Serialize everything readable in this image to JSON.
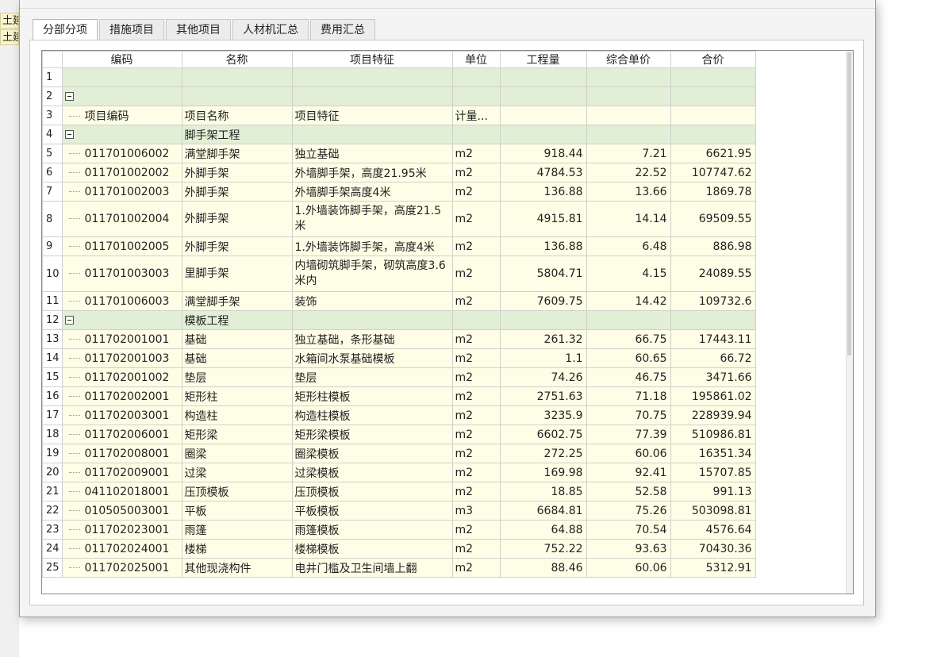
{
  "background": {
    "fragments": [
      "土建",
      "土建"
    ]
  },
  "tabs": [
    {
      "label": "分部分项",
      "active": true
    },
    {
      "label": "措施项目",
      "active": false
    },
    {
      "label": "其他项目",
      "active": false
    },
    {
      "label": "人材机汇总",
      "active": false
    },
    {
      "label": "费用汇总",
      "active": false
    }
  ],
  "grid": {
    "columns": [
      "编码",
      "名称",
      "项目特征",
      "单位",
      "工程量",
      "综合单价",
      "合价"
    ],
    "rows": [
      {
        "num": "1",
        "type": "green",
        "expander": false,
        "code": "",
        "name": "",
        "feature": "",
        "unit": "",
        "qty": "",
        "price": "",
        "total": ""
      },
      {
        "num": "2",
        "type": "green",
        "expander": true,
        "code": "",
        "name": "",
        "feature": "",
        "unit": "",
        "qty": "",
        "price": "",
        "total": ""
      },
      {
        "num": "3",
        "type": "yellow",
        "expander": false,
        "line": true,
        "code": "项目编码",
        "name": "项目名称",
        "feature": "项目特征",
        "unit": "计量...",
        "qty": "",
        "price": "",
        "total": ""
      },
      {
        "num": "4",
        "type": "green",
        "expander": true,
        "code": "",
        "name": "脚手架工程",
        "feature": "",
        "unit": "",
        "qty": "",
        "price": "",
        "total": ""
      },
      {
        "num": "5",
        "type": "yellow",
        "line": true,
        "code": "011701006002",
        "name": "满堂脚手架",
        "feature": "独立基础",
        "unit": "m2",
        "qty": "918.44",
        "price": "7.21",
        "total": "6621.95"
      },
      {
        "num": "6",
        "type": "yellow",
        "line": true,
        "code": "011701002002",
        "name": "外脚手架",
        "feature": "外墙脚手架，高度21.95米",
        "unit": "m2",
        "qty": "4784.53",
        "price": "22.52",
        "total": "107747.62"
      },
      {
        "num": "7",
        "type": "yellow",
        "line": true,
        "code": "011701002003",
        "name": "外脚手架",
        "feature": "外墙脚手架高度4米",
        "unit": "m2",
        "qty": "136.88",
        "price": "13.66",
        "total": "1869.78"
      },
      {
        "num": "8",
        "type": "yellow",
        "line": true,
        "tall": true,
        "code": "011701002004",
        "name": "外脚手架",
        "feature": "1.外墙装饰脚手架，高度21.5米",
        "unit": "m2",
        "qty": "4915.81",
        "price": "14.14",
        "total": "69509.55"
      },
      {
        "num": "9",
        "type": "yellow",
        "line": true,
        "code": "011701002005",
        "name": "外脚手架",
        "feature": "1.外墙装饰脚手架，高度4米",
        "unit": "m2",
        "qty": "136.88",
        "price": "6.48",
        "total": "886.98"
      },
      {
        "num": "10",
        "type": "yellow",
        "line": true,
        "tall": true,
        "code": "011701003003",
        "name": "里脚手架",
        "feature": "内墙砌筑脚手架，砌筑高度3.6米内",
        "unit": "m2",
        "qty": "5804.71",
        "price": "4.15",
        "total": "24089.55"
      },
      {
        "num": "11",
        "type": "yellow",
        "line": true,
        "code": "011701006003",
        "name": "满堂脚手架",
        "feature": "装饰",
        "unit": "m2",
        "qty": "7609.75",
        "price": "14.42",
        "total": "109732.6"
      },
      {
        "num": "12",
        "type": "green",
        "expander": true,
        "code": "",
        "name": "模板工程",
        "feature": "",
        "unit": "",
        "qty": "",
        "price": "",
        "total": ""
      },
      {
        "num": "13",
        "type": "yellow",
        "line": true,
        "code": "011702001001",
        "name": "基础",
        "feature": "独立基础，条形基础",
        "unit": "m2",
        "qty": "261.32",
        "price": "66.75",
        "total": "17443.11"
      },
      {
        "num": "14",
        "type": "yellow",
        "line": true,
        "code": "011702001003",
        "name": "基础",
        "feature": "水箱间水泵基础模板",
        "unit": "m2",
        "qty": "1.1",
        "price": "60.65",
        "total": "66.72"
      },
      {
        "num": "15",
        "type": "yellow",
        "line": true,
        "code": "011702001002",
        "name": "垫层",
        "feature": "垫层",
        "unit": "m2",
        "qty": "74.26",
        "price": "46.75",
        "total": "3471.66"
      },
      {
        "num": "16",
        "type": "yellow",
        "line": true,
        "code": "011702002001",
        "name": "矩形柱",
        "feature": "矩形柱模板",
        "unit": "m2",
        "qty": "2751.63",
        "price": "71.18",
        "total": "195861.02"
      },
      {
        "num": "17",
        "type": "yellow",
        "line": true,
        "code": "011702003001",
        "name": "构造柱",
        "feature": "构造柱模板",
        "unit": "m2",
        "qty": "3235.9",
        "price": "70.75",
        "total": "228939.94"
      },
      {
        "num": "18",
        "type": "yellow",
        "line": true,
        "code": "011702006001",
        "name": "矩形梁",
        "feature": "矩形梁模板",
        "unit": "m2",
        "qty": "6602.75",
        "price": "77.39",
        "total": "510986.81"
      },
      {
        "num": "19",
        "type": "yellow",
        "line": true,
        "code": "011702008001",
        "name": "圈梁",
        "feature": "圈梁模板",
        "unit": "m2",
        "qty": "272.25",
        "price": "60.06",
        "total": "16351.34"
      },
      {
        "num": "20",
        "type": "yellow",
        "line": true,
        "code": "011702009001",
        "name": "过梁",
        "feature": "过梁模板",
        "unit": "m2",
        "qty": "169.98",
        "price": "92.41",
        "total": "15707.85"
      },
      {
        "num": "21",
        "type": "yellow",
        "line": true,
        "code": "041102018001",
        "name": "压顶模板",
        "feature": "压顶模板",
        "unit": "m2",
        "qty": "18.85",
        "price": "52.58",
        "total": "991.13"
      },
      {
        "num": "22",
        "type": "yellow",
        "line": true,
        "code": "010505003001",
        "name": "平板",
        "feature": "平板模板",
        "unit": "m3",
        "qty": "6684.81",
        "price": "75.26",
        "total": "503098.81"
      },
      {
        "num": "23",
        "type": "yellow",
        "line": true,
        "code": "011702023001",
        "name": "雨篷",
        "feature": "雨篷模板",
        "unit": "m2",
        "qty": "64.88",
        "price": "70.54",
        "total": "4576.64"
      },
      {
        "num": "24",
        "type": "yellow",
        "line": true,
        "code": "011702024001",
        "name": "楼梯",
        "feature": "楼梯模板",
        "unit": "m2",
        "qty": "752.22",
        "price": "93.63",
        "total": "70430.36"
      },
      {
        "num": "25",
        "type": "yellow",
        "line": true,
        "code": "011702025001",
        "name": "其他现浇构件",
        "feature": "电井门槛及卫生间墙上翻",
        "unit": "m2",
        "qty": "88.46",
        "price": "60.06",
        "total": "5312.91"
      }
    ]
  }
}
